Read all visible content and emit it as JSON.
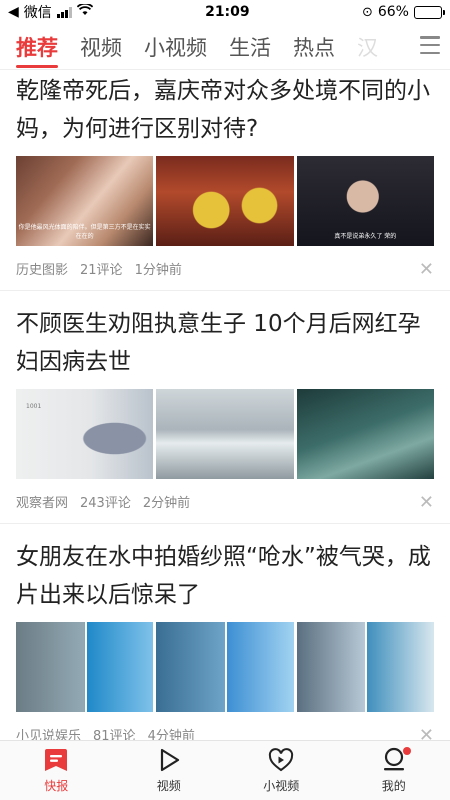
{
  "status_bar": {
    "carrier": "微信",
    "time": "21:09",
    "battery": "66%",
    "battery_level": 0.66
  },
  "tabs": [
    {
      "label": "推荐"
    },
    {
      "label": "视频"
    },
    {
      "label": "小视频"
    },
    {
      "label": "生活"
    },
    {
      "label": "热点"
    },
    {
      "label": "汉"
    }
  ],
  "articles": [
    {
      "title": "乾隆帝死后，嘉庆帝对众多处境不同的小妈，为何进行区别对待?",
      "source": "历史图影",
      "comments": "21评论",
      "time": "1分钟前",
      "image_texts": [
        "你是他最风光体面的陪伴。但是第三方不是在实实在在的",
        "真不是说弟永久了 荣的"
      ]
    },
    {
      "title": "不顾医生劝阻执意生子 10个月后网红孕妇因病去世",
      "source": "观察者网",
      "comments": "243评论",
      "time": "2分钟前",
      "image_texts": [
        "1001"
      ]
    },
    {
      "title": "女朋友在水中拍婚纱照“呛水”被气哭，成片出来以后惊呆了",
      "source": "小见说娱乐",
      "comments": "81评论",
      "time": "4分钟前",
      "image_texts": []
    }
  ],
  "bottom_nav": [
    {
      "label": "快报",
      "icon": "news-icon"
    },
    {
      "label": "视频",
      "icon": "play-icon"
    },
    {
      "label": "小视频",
      "icon": "heart-play-icon"
    },
    {
      "label": "我的",
      "icon": "profile-icon"
    }
  ],
  "colors": {
    "accent": "#e93b3b",
    "text": "#222222",
    "meta": "#888888"
  }
}
